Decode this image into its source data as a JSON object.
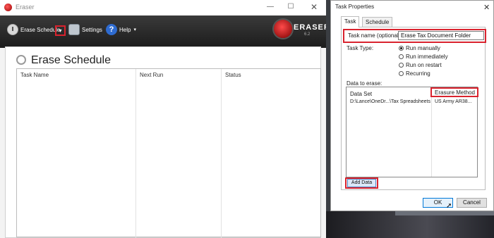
{
  "eraser_window": {
    "title": "Eraser",
    "window_controls": {
      "minimize": "—",
      "maximize": "☐",
      "close": "✕"
    },
    "toolbar": {
      "erase_schedule_label": "Erase Schedule",
      "dropdown_glyph": "▾",
      "settings_label": "Settings",
      "help_label": "Help",
      "help_glyph": "?",
      "help_caret": "▾"
    },
    "logo": {
      "text": "ERASER",
      "version": "6.2"
    },
    "page_title": "Erase Schedule",
    "table_columns": [
      "Task Name",
      "Next Run",
      "Status"
    ]
  },
  "task_properties": {
    "title": "Task Properties",
    "close_glyph": "✕",
    "tabs": [
      "Task",
      "Schedule"
    ],
    "task_name_label": "Task name (optional):",
    "task_name_value": "Erase Tax Document Folder",
    "task_type_label": "Task Type:",
    "task_type_options": [
      "Run manually",
      "Run immediately",
      "Run on restart",
      "Recurring"
    ],
    "selected_task_type": "Run manually",
    "data_to_erase_label": "Data to erase:",
    "data_columns": [
      "Data Set",
      "Erasure Method"
    ],
    "data_rows": [
      {
        "data_set": "D:\\Lance\\OneDr...\\Tax Spreadsheets",
        "method": "US Army AR38..."
      }
    ],
    "add_data_label": "Add Data",
    "ok_label": "OK",
    "cancel_label": "Cancel"
  },
  "colors": {
    "highlight_red": "#d9232e",
    "toolbar_dark": "#1c1c1c",
    "accent_blue": "#0078d7"
  }
}
